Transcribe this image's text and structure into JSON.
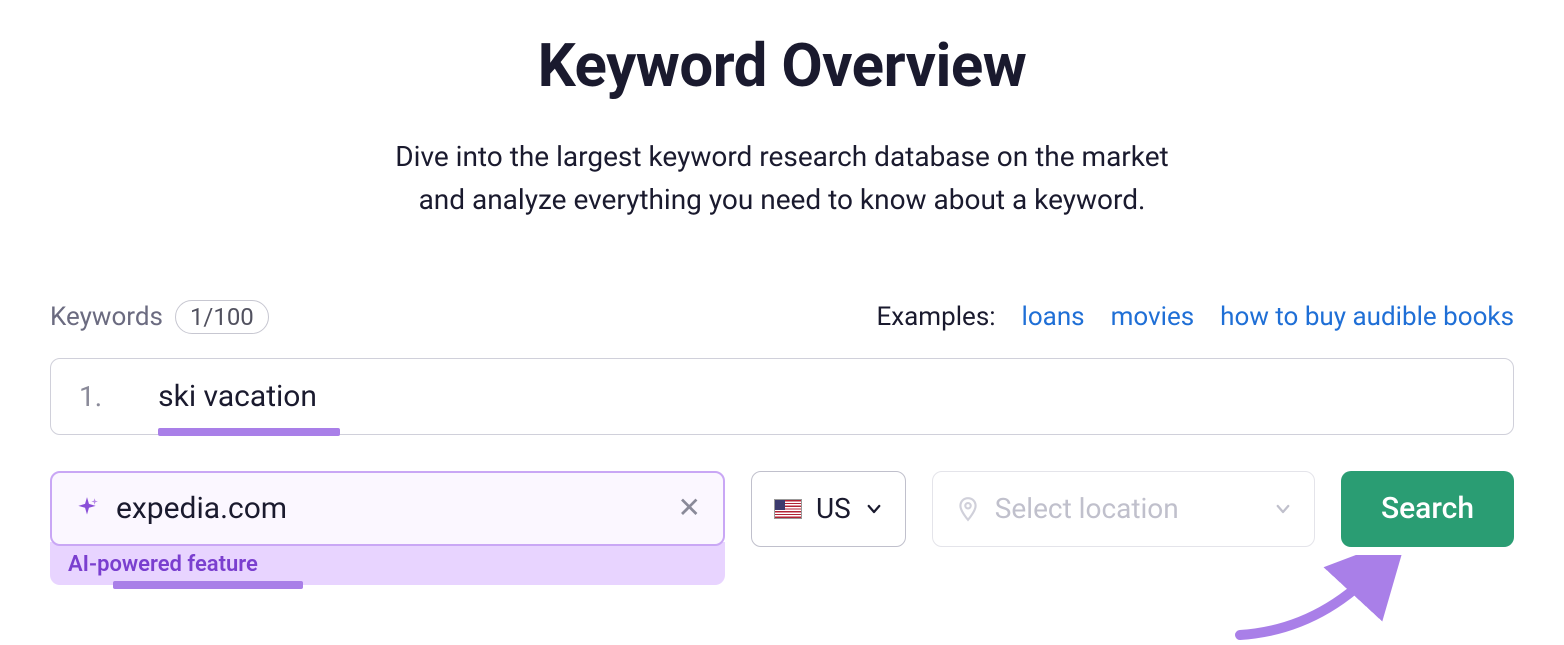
{
  "header": {
    "title": "Keyword Overview",
    "subtitle_line1": "Dive into the largest keyword research database on the market",
    "subtitle_line2": "and analyze everything you need to know about a keyword."
  },
  "keywords": {
    "label": "Keywords",
    "count": "1/100",
    "items": [
      {
        "index": "1.",
        "value": "ski vacation"
      }
    ]
  },
  "examples": {
    "label": "Examples:",
    "links": [
      "loans",
      "movies",
      "how to buy audible books"
    ]
  },
  "ai_feature": {
    "domain_value": "expedia.com",
    "badge_label": "AI-powered feature"
  },
  "country": {
    "code": "US"
  },
  "location": {
    "placeholder": "Select location"
  },
  "actions": {
    "search_label": "Search"
  },
  "colors": {
    "accent_purple": "#a97fe8",
    "link_blue": "#1f6fd6",
    "button_green": "#2a9d73"
  }
}
